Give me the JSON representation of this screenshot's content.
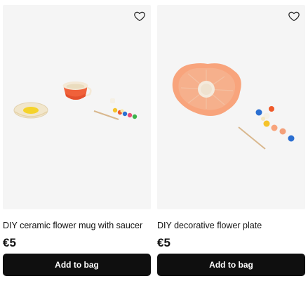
{
  "products": [
    {
      "title": "DIY ceramic flower mug with saucer",
      "price": "€5",
      "button_label": "Add to bag",
      "image": "ceramic-mug-saucer-paint-set"
    },
    {
      "title": "DIY decorative flower plate",
      "price": "€5",
      "button_label": "Add to bag",
      "image": "flower-plate-paint-set"
    }
  ],
  "icons": {
    "favorite": "heart-outline-icon"
  },
  "colors": {
    "button_bg": "#0f0f0f",
    "button_text": "#ffffff",
    "image_bg": "#f5f5f5"
  }
}
